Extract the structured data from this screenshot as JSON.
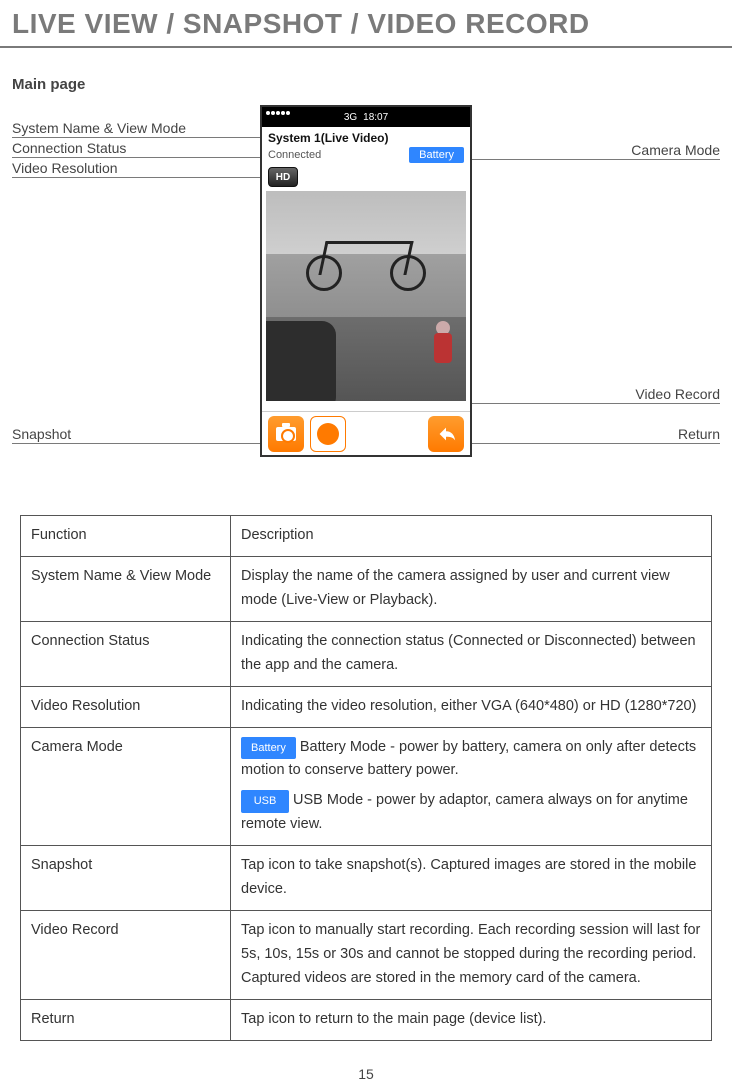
{
  "title": "LIVE VIEW / SNAPSHOT / VIDEO RECORD",
  "subheading": "Main page",
  "labels": {
    "left1": "System Name & View Mode",
    "left2": "Connection Status",
    "left3": "Video Resolution",
    "left4": "Snapshot",
    "right1": "Camera Mode",
    "right2": "Video Record",
    "right3": "Return"
  },
  "phone": {
    "status_time": "18:07",
    "status_net": "3G",
    "system_line": "System 1(Live Video)",
    "connected": "Connected",
    "battery_label": "Battery",
    "hd_label": "HD"
  },
  "table": {
    "h1": "Function",
    "h2": "Description",
    "rows": [
      {
        "f": "System Name & View Mode",
        "d": "Display the name of the camera assigned by user and current view mode (Live-View or Playback)."
      },
      {
        "f": "Connection Status",
        "d": "Indicating the connection status (Connected or Disconnected) between the app and the camera."
      },
      {
        "f": "Video Resolution",
        "d": "Indicating the video resolution, either VGA (640*480) or HD (1280*720)"
      },
      {
        "f": "Camera Mode",
        "battery_tag": "Battery",
        "battery_text": " Battery Mode - power by battery, camera on only after detects motion to conserve battery power.",
        "usb_tag": "USB",
        "usb_text": " USB Mode - power by adaptor, camera always on for anytime remote view."
      },
      {
        "f": "Snapshot",
        "d": "Tap icon to take snapshot(s).  Captured images are stored in the mobile device."
      },
      {
        "f": "Video Record",
        "d": "Tap icon to manually start recording.  Each recording session will last for 5s, 10s, 15s or 30s and cannot be stopped during the recording period.  Captured videos are stored in the memory card of the camera."
      },
      {
        "f": "Return",
        "d": "Tap icon to return to the main page (device list)."
      }
    ]
  },
  "page_number": "15"
}
